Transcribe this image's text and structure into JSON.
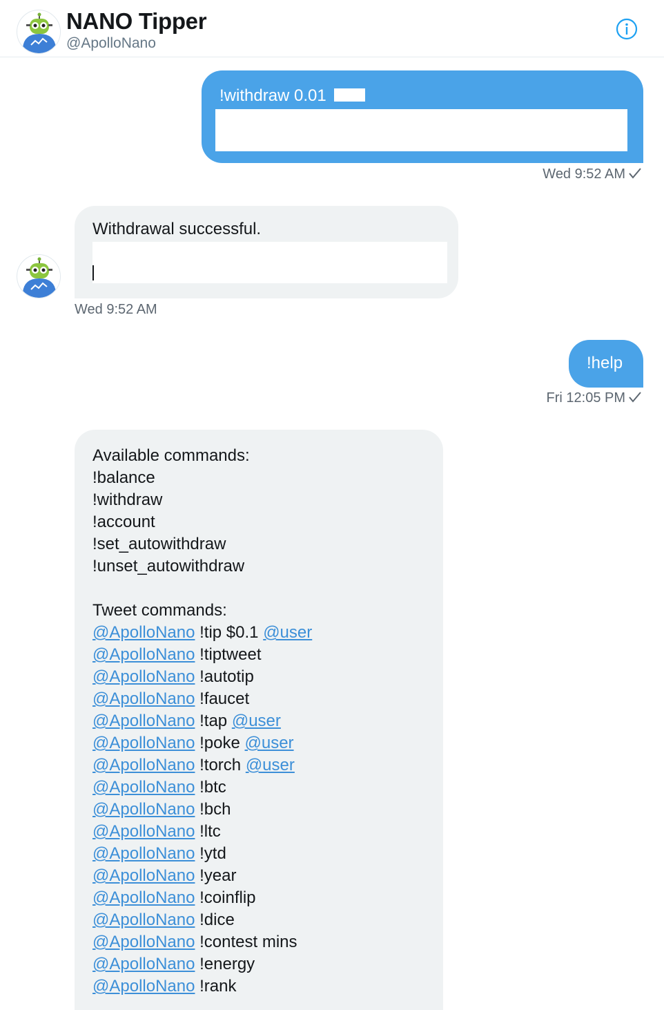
{
  "header": {
    "title": "NANO Tipper",
    "handle": "@ApolloNano",
    "info_icon": "info-icon"
  },
  "messages": [
    {
      "sender": "me",
      "text": "!withdraw 0.01",
      "time": "Wed 9:52 AM",
      "status_icon": "check-icon"
    },
    {
      "sender": "bot",
      "text": "Withdrawal successful.",
      "time": "Wed 9:52 AM"
    },
    {
      "sender": "me",
      "text": "!help",
      "time": "Fri 12:05 PM",
      "status_icon": "check-icon"
    }
  ],
  "help": {
    "available_title": "Available commands:",
    "commands": [
      "!balance",
      "!withdraw",
      "!account",
      "!set_autowithdraw",
      "!unset_autowithdraw"
    ],
    "tweet_title": "Tweet commands:",
    "tweet_commands": [
      {
        "mention": "@ApolloNano",
        "cmd": " !tip $0.1 ",
        "target": "@user"
      },
      {
        "mention": "@ApolloNano",
        "cmd": " !tiptweet",
        "target": ""
      },
      {
        "mention": "@ApolloNano",
        "cmd": " !autotip",
        "target": ""
      },
      {
        "mention": "@ApolloNano",
        "cmd": " !faucet",
        "target": ""
      },
      {
        "mention": "@ApolloNano",
        "cmd": " !tap ",
        "target": "@user"
      },
      {
        "mention": "@ApolloNano",
        "cmd": " !poke ",
        "target": "@user"
      },
      {
        "mention": "@ApolloNano",
        "cmd": " !torch ",
        "target": "@user"
      },
      {
        "mention": "@ApolloNano",
        "cmd": " !btc",
        "target": ""
      },
      {
        "mention": "@ApolloNano",
        "cmd": " !bch",
        "target": ""
      },
      {
        "mention": "@ApolloNano",
        "cmd": " !ltc",
        "target": ""
      },
      {
        "mention": "@ApolloNano",
        "cmd": " !ytd",
        "target": ""
      },
      {
        "mention": "@ApolloNano",
        "cmd": " !year",
        "target": ""
      },
      {
        "mention": "@ApolloNano",
        "cmd": " !coinflip",
        "target": ""
      },
      {
        "mention": "@ApolloNano",
        "cmd": " !dice",
        "target": ""
      },
      {
        "mention": "@ApolloNano",
        "cmd": " !contest mins",
        "target": ""
      },
      {
        "mention": "@ApolloNano",
        "cmd": " !energy",
        "target": ""
      },
      {
        "mention": "@ApolloNano",
        "cmd": " !rank",
        "target": ""
      }
    ]
  },
  "colors": {
    "accent": "#1da1f2",
    "bubble_out": "#4aa3e8",
    "bubble_in": "#eff2f3",
    "link": "#3c8fd8"
  }
}
